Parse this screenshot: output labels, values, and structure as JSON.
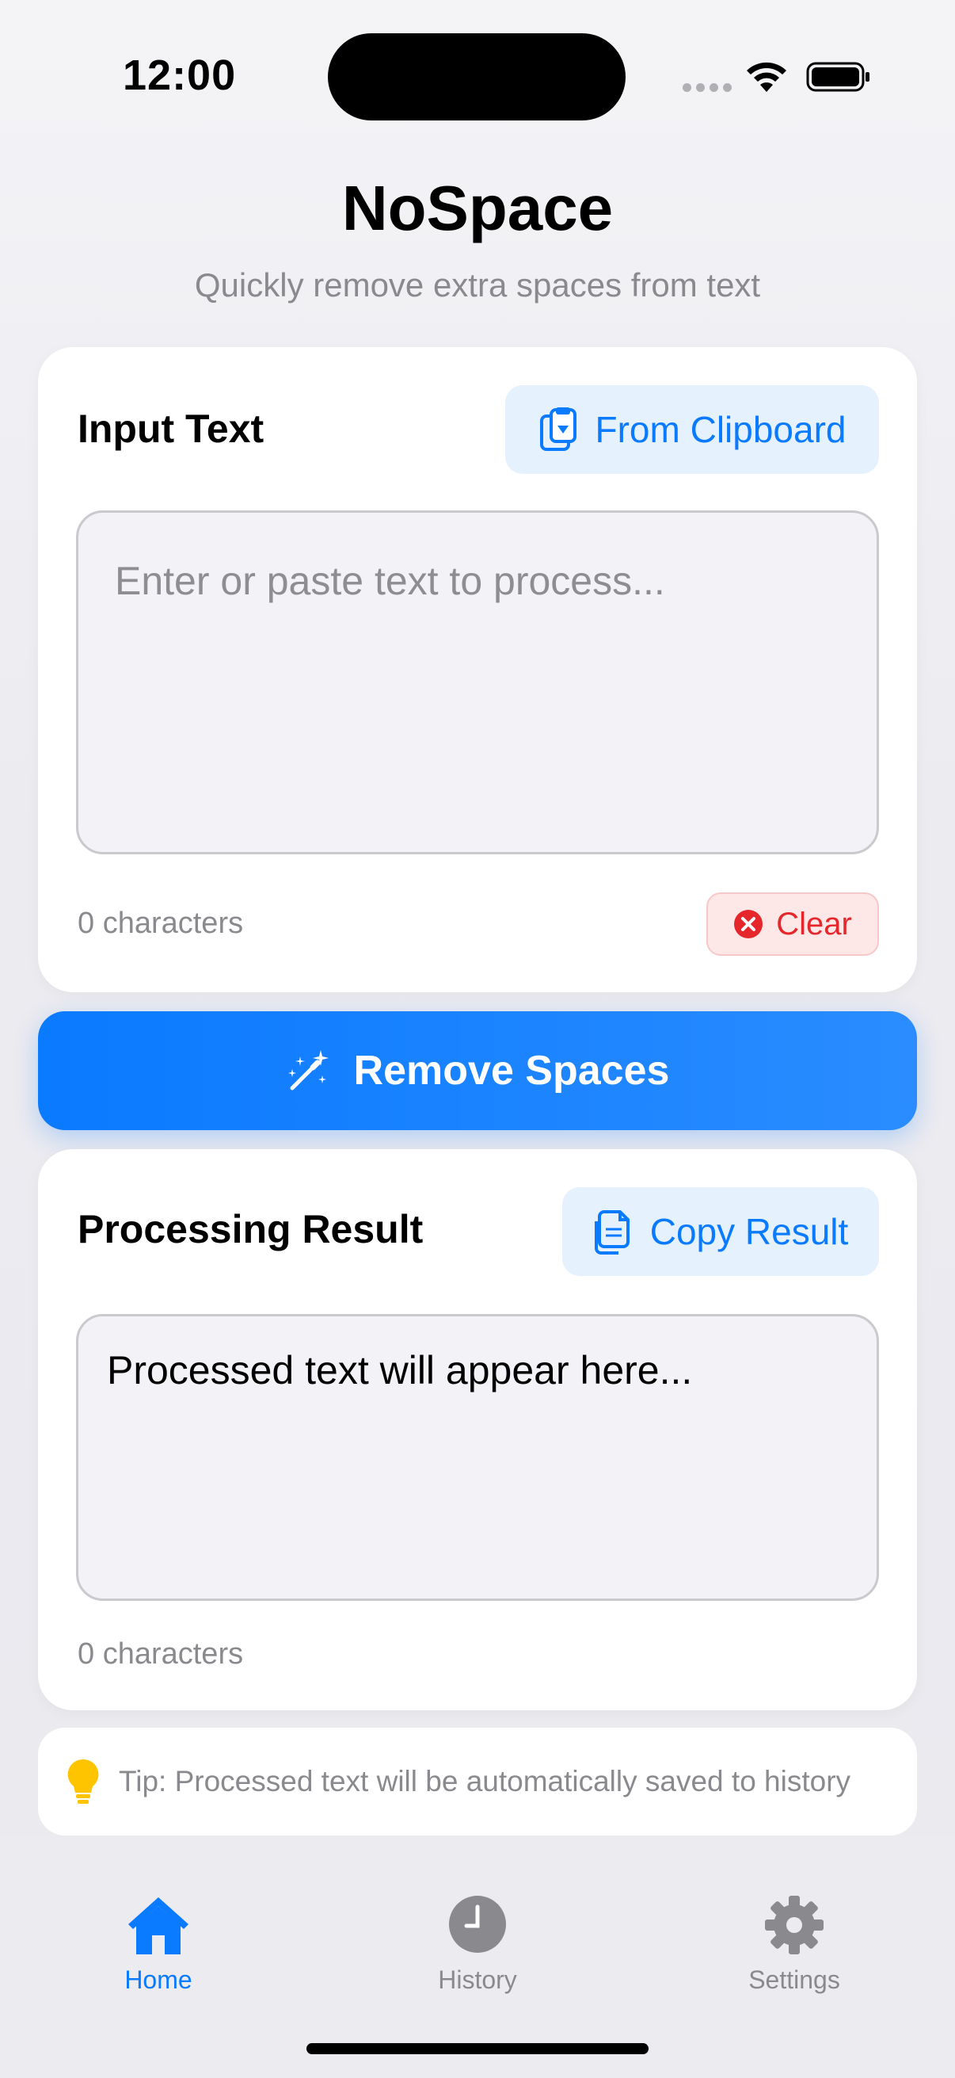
{
  "status_bar": {
    "time": "12:00"
  },
  "header": {
    "title": "NoSpace",
    "subtitle": "Quickly remove extra spaces from text"
  },
  "input_card": {
    "label": "Input Text",
    "clipboard_button": "From Clipboard",
    "placeholder": "Enter or paste text to process...",
    "char_count": "0 characters",
    "clear_button": "Clear"
  },
  "primary_action": {
    "label": "Remove Spaces"
  },
  "result_card": {
    "label": "Processing Result",
    "copy_button": "Copy Result",
    "result_text": "Processed text will appear here...",
    "char_count": "0 characters"
  },
  "tip": {
    "text": "Tip: Processed text will be automatically saved to history"
  },
  "tab_bar": {
    "active": "home",
    "items": [
      {
        "id": "home",
        "label": "Home",
        "icon": "house-icon"
      },
      {
        "id": "history",
        "label": "History",
        "icon": "clock-icon"
      },
      {
        "id": "settings",
        "label": "Settings",
        "icon": "gear-icon"
      }
    ]
  },
  "colors": {
    "accent": "#0A7AFF",
    "destructive": "#E5262A",
    "tip_bulb": "#FFC400",
    "muted": "#8A8A8E"
  }
}
